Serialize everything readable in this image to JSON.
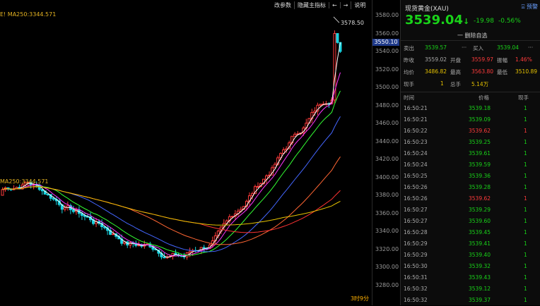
{
  "toolbar": {
    "items": [
      "改参数",
      "隐藏主指标",
      "←",
      "→",
      "说明"
    ]
  },
  "ma_label_top": "E!  MA250:3344.571",
  "ma_label_bottom": "MA250:3344.571",
  "corner_label": "3时9分",
  "y_axis": {
    "ticks": [
      "3580.00",
      "3560.00",
      "3540.00",
      "3520.00",
      "3500.00",
      "3480.00",
      "3460.00",
      "3440.00",
      "3420.00",
      "3400.00",
      "3380.00",
      "3360.00",
      "3340.00",
      "3320.00",
      "3300.00",
      "3280.00"
    ],
    "high_label": "3578.50",
    "current_tag": "3550.10"
  },
  "panel": {
    "title": "现货黄金(XAU)",
    "watch_label": "预警",
    "price": "3539.04",
    "arrow": "↓",
    "change": "-19.98",
    "change_pct": "-0.56%",
    "delete_label": "一 删除自选",
    "rows": [
      [
        {
          "l": "卖出",
          "v": "3539.57",
          "c": "green"
        },
        {
          "l": "···",
          "v": "",
          "c": "gray"
        },
        {
          "l": "买入",
          "v": "3539.04",
          "c": "green"
        },
        {
          "l": "···",
          "v": "",
          "c": "gray"
        }
      ],
      [
        {
          "l": "昨收",
          "v": "3559.02",
          "c": "gray"
        },
        {
          "l": "开盘",
          "v": "3559.97",
          "c": "red"
        },
        {
          "l": "振幅",
          "v": "1.46%",
          "c": "red"
        }
      ],
      [
        {
          "l": "均价",
          "v": "3486.82",
          "c": "yellow"
        },
        {
          "l": "最高",
          "v": "3563.80",
          "c": "red"
        },
        {
          "l": "最低",
          "v": "3510.89",
          "c": "yellow"
        }
      ],
      [
        {
          "l": "现手",
          "v": "1",
          "c": "yellow"
        },
        {
          "l": "总手",
          "v": "5.14万",
          "c": "yellow"
        }
      ]
    ],
    "table_headers": [
      "时间",
      "价格",
      "现手"
    ],
    "trades": [
      [
        "16:50:21",
        "3539.18",
        "1"
      ],
      [
        "16:50:21",
        "3539.09",
        "1"
      ],
      [
        "16:50:22",
        "3539.62",
        "1"
      ],
      [
        "16:50:23",
        "3539.25",
        "1"
      ],
      [
        "16:50:24",
        "3539.61",
        "1"
      ],
      [
        "16:50:24",
        "3539.59",
        "1"
      ],
      [
        "16:50:25",
        "3539.36",
        "1"
      ],
      [
        "16:50:26",
        "3539.28",
        "1"
      ],
      [
        "16:50:26",
        "3539.62",
        "1"
      ],
      [
        "16:50:27",
        "3539.29",
        "1"
      ],
      [
        "16:50:27",
        "3539.60",
        "1"
      ],
      [
        "16:50:28",
        "3539.45",
        "1"
      ],
      [
        "16:50:29",
        "3539.41",
        "1"
      ],
      [
        "16:50:29",
        "3539.40",
        "1"
      ],
      [
        "16:50:30",
        "3539.32",
        "1"
      ],
      [
        "16:50:31",
        "3539.43",
        "1"
      ],
      [
        "16:50:32",
        "3539.12",
        "1"
      ],
      [
        "16:50:32",
        "3539.37",
        "1"
      ]
    ],
    "trade_colors": [
      "green",
      "green",
      "red",
      "green",
      "green",
      "green",
      "green",
      "green",
      "red",
      "green",
      "green",
      "green",
      "green",
      "green",
      "green",
      "green",
      "green",
      "green"
    ]
  },
  "colors": {
    "up": "#ff3b3b",
    "down": "#19d319",
    "bg": "#000000",
    "tag": "#1f3a8a"
  }
}
